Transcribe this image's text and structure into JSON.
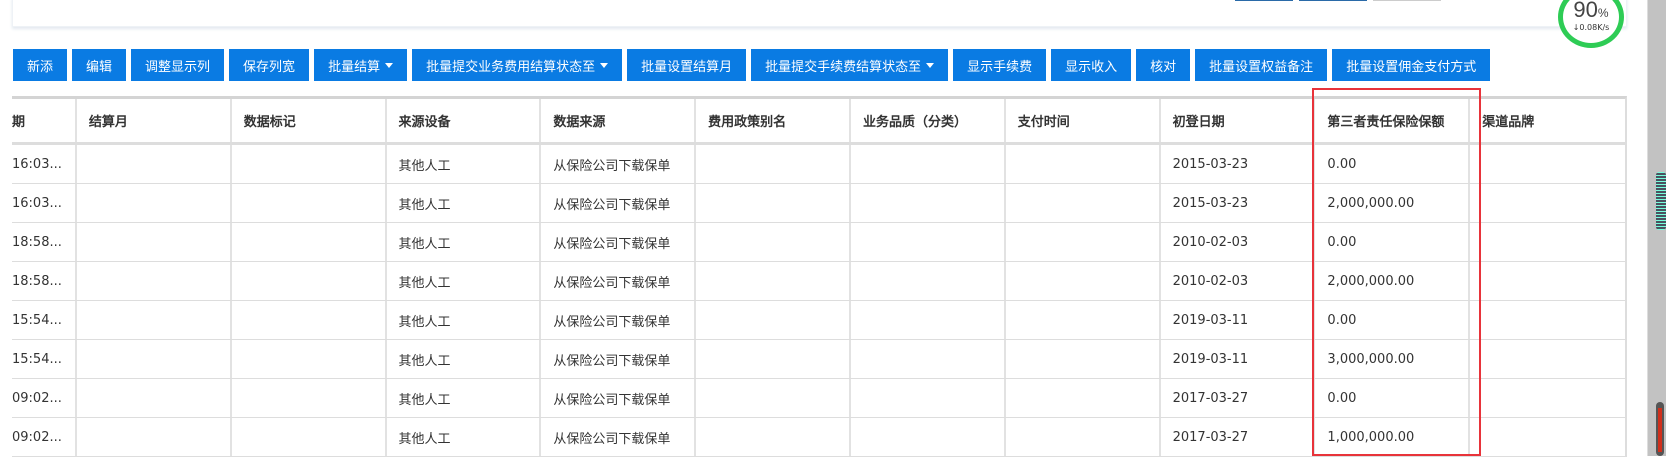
{
  "toolbar": {
    "buttons": [
      {
        "label": "新添",
        "dropdown": false
      },
      {
        "label": "编辑",
        "dropdown": false
      },
      {
        "label": "调整显示列",
        "dropdown": false
      },
      {
        "label": "保存列宽",
        "dropdown": false
      },
      {
        "label": "批量结算",
        "dropdown": true
      },
      {
        "label": "批量提交业务费用结算状态至",
        "dropdown": true
      },
      {
        "label": "批量设置结算月",
        "dropdown": false
      },
      {
        "label": "批量提交手续费结算状态至",
        "dropdown": true
      },
      {
        "label": "显示手续费",
        "dropdown": false
      },
      {
        "label": "显示收入",
        "dropdown": false
      },
      {
        "label": "核对",
        "dropdown": false
      },
      {
        "label": "批量设置权益备注",
        "dropdown": false
      },
      {
        "label": "批量设置佣金支付方式",
        "dropdown": false
      }
    ]
  },
  "table": {
    "columns": [
      "期",
      "结算月",
      "数据标记",
      "来源设备",
      "数据来源",
      "费用政策别名",
      "业务品质（分类）",
      "支付时间",
      "初登日期",
      "第三者责任保险保额",
      "渠道品牌"
    ],
    "rows": [
      [
        "16:03...",
        "",
        "",
        "其他人工",
        "从保险公司下载保单",
        "",
        "",
        "",
        "2015-03-23",
        "0.00",
        ""
      ],
      [
        "16:03...",
        "",
        "",
        "其他人工",
        "从保险公司下载保单",
        "",
        "",
        "",
        "2015-03-23",
        "2,000,000.00",
        ""
      ],
      [
        "18:58...",
        "",
        "",
        "其他人工",
        "从保险公司下载保单",
        "",
        "",
        "",
        "2010-02-03",
        "0.00",
        ""
      ],
      [
        "18:58...",
        "",
        "",
        "其他人工",
        "从保险公司下载保单",
        "",
        "",
        "",
        "2010-02-03",
        "2,000,000.00",
        ""
      ],
      [
        "15:54...",
        "",
        "",
        "其他人工",
        "从保险公司下载保单",
        "",
        "",
        "",
        "2019-03-11",
        "0.00",
        ""
      ],
      [
        "15:54...",
        "",
        "",
        "其他人工",
        "从保险公司下载保单",
        "",
        "",
        "",
        "2019-03-11",
        "3,000,000.00",
        ""
      ],
      [
        "09:02...",
        "",
        "",
        "其他人工",
        "从保险公司下载保单",
        "",
        "",
        "",
        "2017-03-27",
        "0.00",
        ""
      ],
      [
        "09:02...",
        "",
        "",
        "其他人工",
        "从保险公司下载保单",
        "",
        "",
        "",
        "2017-03-27",
        "1,000,000.00",
        ""
      ]
    ]
  },
  "gauge": {
    "percent": "90",
    "unit": "%",
    "speed": "↓0.08K/s"
  },
  "colors": {
    "accent": "#0a7be3",
    "highlight": "#e8333a",
    "gauge": "#2ecc55"
  }
}
